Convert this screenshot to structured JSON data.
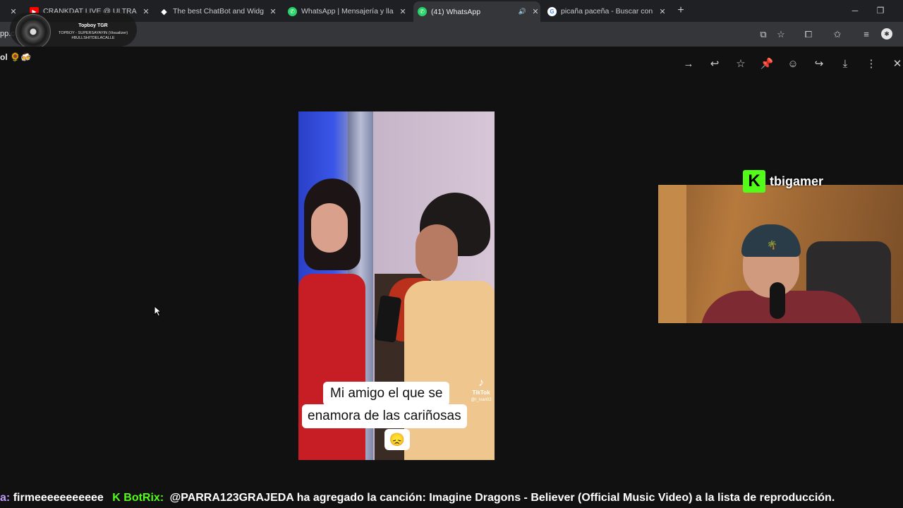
{
  "tabs": [
    {
      "title": "CRANKDAT LIVE @ ULTRA MUSIC",
      "favicon": "youtube-icon",
      "color": "#ff0000"
    },
    {
      "title": "The best ChatBot and Widgets for",
      "favicon": "diamond-icon",
      "color": "#ffffff"
    },
    {
      "title": "WhatsApp | Mensajería y llamadas",
      "favicon": "whatsapp-icon",
      "color": "#25d366"
    },
    {
      "title": "(41) WhatsApp",
      "favicon": "whatsapp-icon",
      "color": "#25d366"
    },
    {
      "title": "picaña paceña - Buscar con Google",
      "favicon": "google-icon",
      "color": "#4285f4"
    }
  ],
  "toolbar": {
    "url_fragment": "pp.c"
  },
  "now_playing": {
    "title": "Topboy TGR",
    "line1": "TOPBOY - SUPERSAYAYIN (Visualizer)",
    "line2": "#BULLSHITDELACALLE"
  },
  "viewer": {
    "caption_fragment": "ol 🌻🍻",
    "video": {
      "subtitle_line1": "Mi amigo el que se",
      "subtitle_line2": "enamora de las cariñosas",
      "subtitle_emoji": "😞",
      "watermark": "TikTok",
      "watermark_user": "@r_ivan02"
    }
  },
  "streamer": {
    "name": "tbigamer",
    "platform_logo": "K"
  },
  "chat": {
    "user_fragment": "a:",
    "message": "firmeeeeeeeeeee",
    "bot_name": "BotRix:",
    "bot_message": "@PARRA123GRAJEDA ha agregado la canción: Imagine Dragons - Believer (Official Music Video) a la lista de reproducción."
  }
}
